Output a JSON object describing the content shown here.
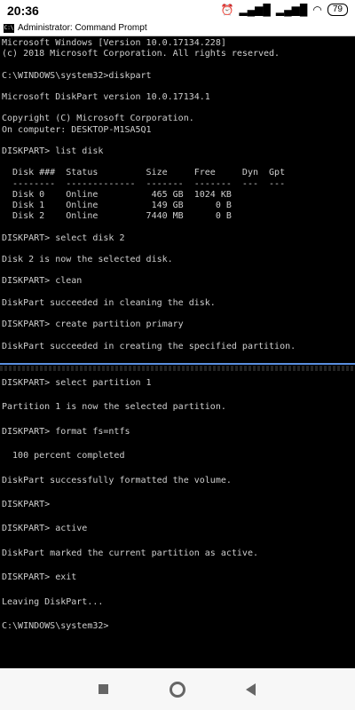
{
  "status_bar": {
    "time": "20:36",
    "battery": "79",
    "icons": [
      "alarm-icon",
      "signal-icon",
      "signal-icon",
      "wifi-icon",
      "battery-icon"
    ]
  },
  "window": {
    "title": "Administrator: Command Prompt",
    "icon_label": "C:\\"
  },
  "console": {
    "text_color": "#cfcfcf",
    "background": "#000000",
    "pane_top": [
      "Microsoft Windows [Version 10.0.17134.228]",
      "(c) 2018 Microsoft Corporation. All rights reserved.",
      "",
      "C:\\WINDOWS\\system32>diskpart",
      "",
      "Microsoft DiskPart version 10.0.17134.1",
      "",
      "Copyright (C) Microsoft Corporation.",
      "On computer: DESKTOP-M1SA5Q1",
      "",
      "DISKPART> list disk",
      "",
      "  Disk ###  Status         Size     Free     Dyn  Gpt",
      "  --------  -------------  -------  -------  ---  ---",
      "  Disk 0    Online          465 GB  1024 KB",
      "  Disk 1    Online          149 GB      0 B",
      "  Disk 2    Online         7440 MB      0 B",
      "",
      "DISKPART> select disk 2",
      "",
      "Disk 2 is now the selected disk.",
      "",
      "DISKPART> clean",
      "",
      "DiskPart succeeded in cleaning the disk.",
      "",
      "DISKPART> create partition primary",
      "",
      "DiskPart succeeded in creating the specified partition."
    ],
    "pane_bottom": [
      "DISKPART> select partition 1",
      "",
      "Partition 1 is now the selected partition.",
      "",
      "DISKPART> format fs=ntfs",
      "",
      "  100 percent completed",
      "",
      "DiskPart successfully formatted the volume.",
      "",
      "DISKPART>",
      "",
      "DISKPART> active",
      "",
      "DiskPart marked the current partition as active.",
      "",
      "DISKPART> exit",
      "",
      "Leaving DiskPart...",
      "",
      "C:\\WINDOWS\\system32>"
    ]
  },
  "nav_bar": {
    "buttons": [
      "recent-apps",
      "home",
      "back"
    ]
  }
}
